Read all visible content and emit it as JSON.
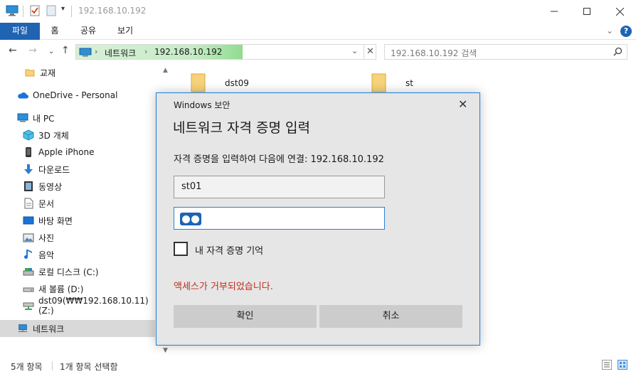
{
  "window": {
    "title": "192.168.10.192",
    "quick_access_icons": [
      "pc-icon",
      "properties-icon",
      "new-folder-icon",
      "customize-dropdown-icon"
    ]
  },
  "ribbon": {
    "tabs": [
      "파일",
      "홈",
      "공유",
      "보기"
    ]
  },
  "address": {
    "crumbs": [
      "네트워크",
      "192.168.10.192"
    ],
    "search_placeholder": "192.168.10.192 검색"
  },
  "sidebar": {
    "items": [
      {
        "label": "교재",
        "icon": "folder-icon"
      },
      {
        "label": "OneDrive - Personal",
        "icon": "cloud-icon"
      },
      {
        "label": "내 PC",
        "icon": "pc-icon"
      },
      {
        "label": "3D 개체",
        "icon": "cube-icon"
      },
      {
        "label": "Apple iPhone",
        "icon": "phone-icon"
      },
      {
        "label": "다운로드",
        "icon": "download-icon"
      },
      {
        "label": "동영상",
        "icon": "video-icon"
      },
      {
        "label": "문서",
        "icon": "document-icon"
      },
      {
        "label": "바탕 화면",
        "icon": "desktop-icon"
      },
      {
        "label": "사진",
        "icon": "picture-icon"
      },
      {
        "label": "음악",
        "icon": "music-icon"
      },
      {
        "label": "로컬 디스크 (C:)",
        "icon": "drive-icon"
      },
      {
        "label": "새 볼륨 (D:)",
        "icon": "drive-icon"
      },
      {
        "label": "dst09(₩₩192.168.10.11) (Z:)",
        "icon": "network-drive-icon"
      },
      {
        "label": "네트워크",
        "icon": "network-icon"
      }
    ]
  },
  "content": {
    "folders": [
      "dst09",
      "st"
    ]
  },
  "status": {
    "count": "5개 항목",
    "selected": "1개 항목 선택함"
  },
  "dialog": {
    "title": "Windows 보안",
    "heading": "네트워크 자격 증명 입력",
    "prompt": "자격 증명을 입력하여 다음에 연결: 192.168.10.192",
    "username": "st01",
    "remember_label": "내 자격 증명 기억",
    "error": "액세스가 거부되었습니다.",
    "ok_label": "확인",
    "cancel_label": "취소"
  },
  "colors": {
    "accent": "#1f63b3",
    "dialog_border": "#1f7fd4",
    "error": "#c42b1c",
    "address_progress": "#8fdc8f"
  }
}
